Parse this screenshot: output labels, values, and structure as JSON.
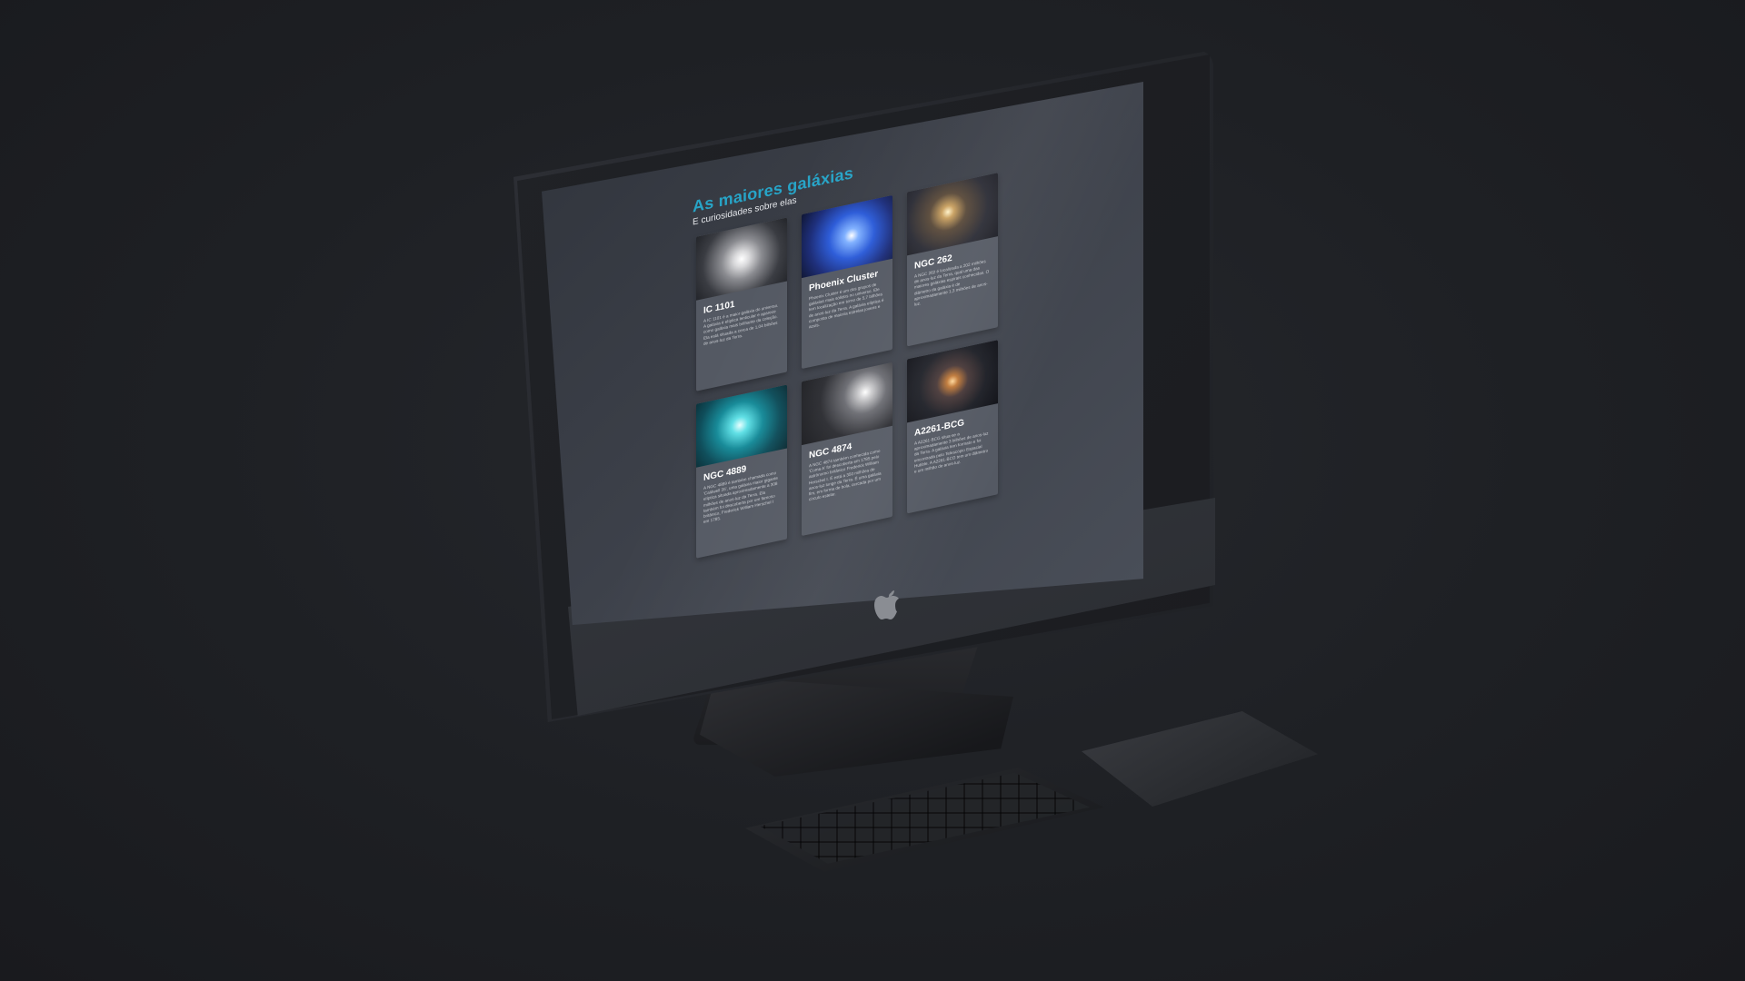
{
  "page": {
    "title": "As maiores galáxias",
    "subtitle": "E curiosidades sobre elas"
  },
  "cards": [
    {
      "name": "IC 1101",
      "image": "galaxy-white",
      "text": "A IC 1101 é a maior galáxia do universo. A galáxia é elíptica lenticular e aparece como galáxia mais brilhante da coleção. Ela está situada a cerca de 1,04 bilhões de anos-luz da Terra."
    },
    {
      "name": "Phoenix Cluster",
      "image": "galaxy-blue",
      "text": "Phoenix Cluster é um dos grupos de galáxias mais sólidos no universo. Ele tem localização em torno de 5,7 bilhões de anos-luz da Terra. A galáxia elíptica é composta de maioria estrelas jovens e azuis."
    },
    {
      "name": "NGC 262",
      "image": "galaxy-gold",
      "text": "A NGC 262 é localizada a 202 milhões de anos-luz da Terra, qual uma das maiores galáxias espirais conhecidas. O diâmetro da galáxia é de aproximadamente 1,3 milhões de anos-luz."
    },
    {
      "name": "NGC 4889",
      "image": "galaxy-cyan",
      "text": "A NGC 4889 é também chamada como 'Caldwell 35', uma galáxia maior gigante elíptica situada aproximadamente a 308 milhões de anos-luz da Terra. Ela também foi descoberta por um famoso britânico, Frederick William Herschel I em 1785."
    },
    {
      "name": "NGC 4874",
      "image": "galaxy-grey",
      "text": "A NGC 4874 também conhecida como 'Coma A' foi descoberta em 1785 pelo astrônomo britânico Frederick William Herschel I. É está a 350 milhões de anos-luz longe da Terra. É uma galáxia fim, em forma de bola, cercada por um círculo estelar."
    },
    {
      "name": "A2261-BCG",
      "image": "galaxy-orange",
      "text": "A A2261-BCG situa-se a aproximadamente 3 bilhões de anos-luz da Terra. A galáxia tem formato e foi encontrada pelo Telescópio Espacial Hubble. A A2261-BCG tem um diâmetro e um milhão de anos-luz."
    }
  ],
  "device": {
    "logo": "apple-logo-icon",
    "colors": {
      "accent": "#27a4c7",
      "card": "#545963",
      "screen": "#3c4049",
      "background": "#1e2024"
    }
  }
}
